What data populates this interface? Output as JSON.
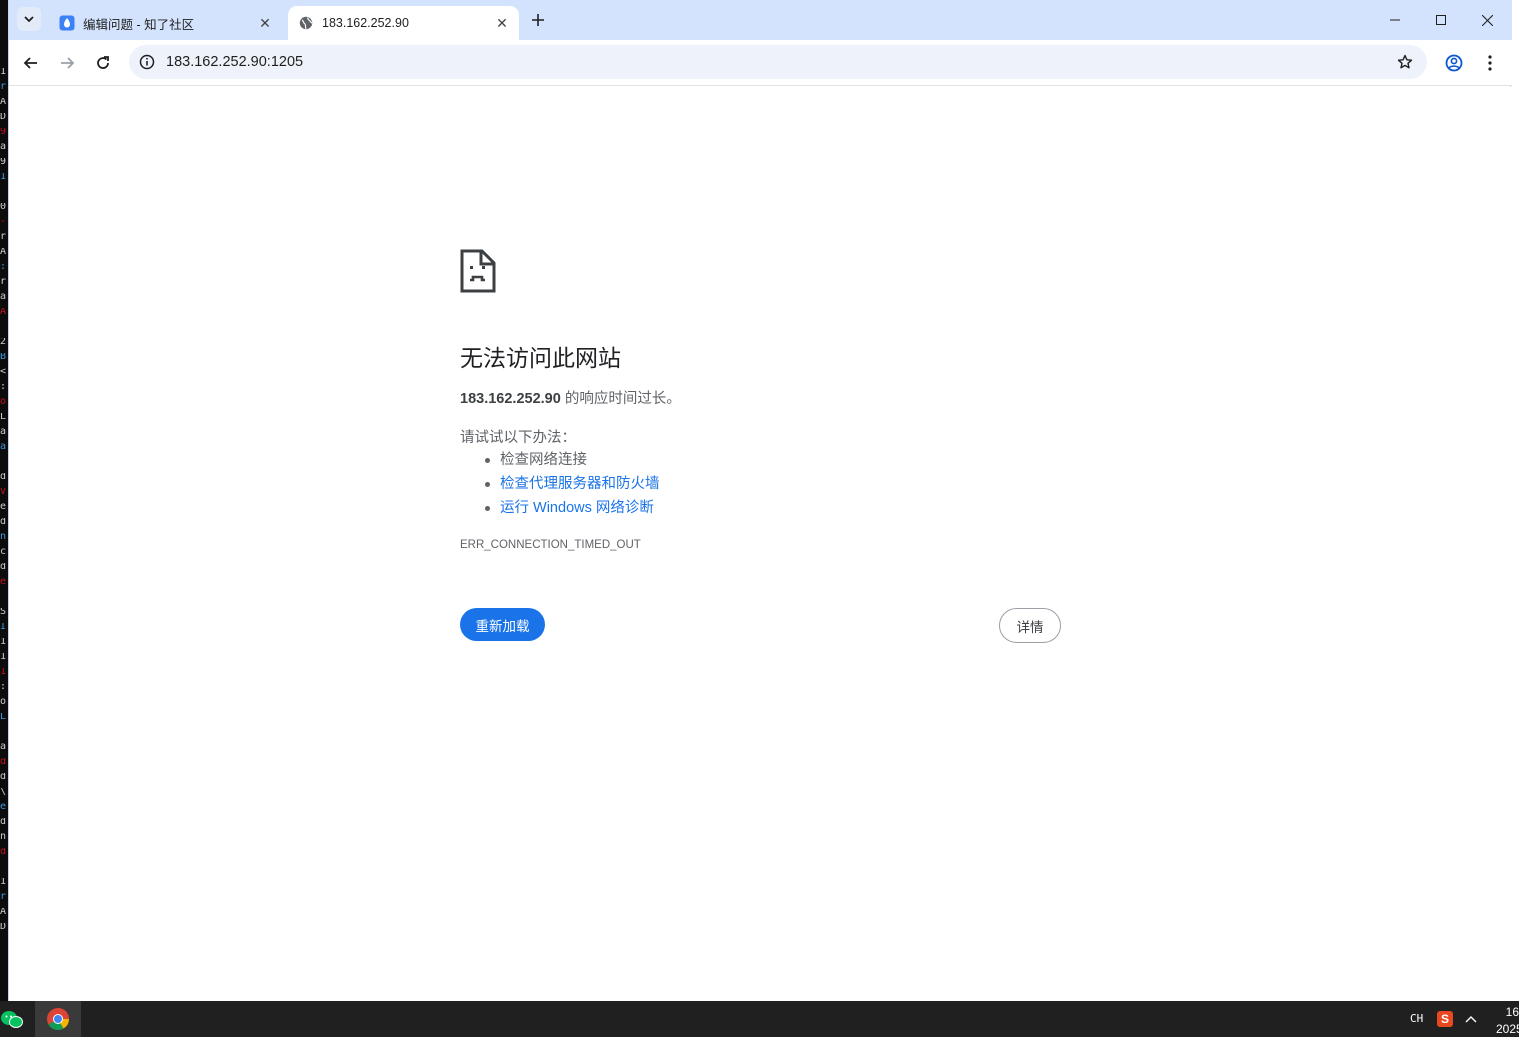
{
  "browser": {
    "tabs": [
      {
        "title": "编辑问题 - 知了社区",
        "active": false,
        "icon": "zhile-community-icon"
      },
      {
        "title": "183.162.252.90",
        "active": true,
        "icon": "globe-icon"
      }
    ],
    "address_url": "183.162.252.90:1205"
  },
  "error_page": {
    "title": "无法访问此网站",
    "host": "183.162.252.90",
    "message_suffix": " 的响应时间过长。",
    "try_label": "请试试以下办法：",
    "suggestions": [
      {
        "text": "检查网络连接",
        "link": false
      },
      {
        "text": "检查代理服务器和防火墙",
        "link": true
      },
      {
        "text": "运行 Windows 网络诊断",
        "link": true
      }
    ],
    "error_code": "ERR_CONNECTION_TIMED_OUT",
    "reload_button": "重新加载",
    "details_button": "详情"
  },
  "taskbar": {
    "ime": "CH",
    "sogou": "S",
    "time_fragment": "16",
    "date_fragment": "2025"
  },
  "colors": {
    "accent": "#1a73e8",
    "tabstrip": "#d3e3fd",
    "link": "#1a73e8",
    "taskbar": "#202020"
  }
}
